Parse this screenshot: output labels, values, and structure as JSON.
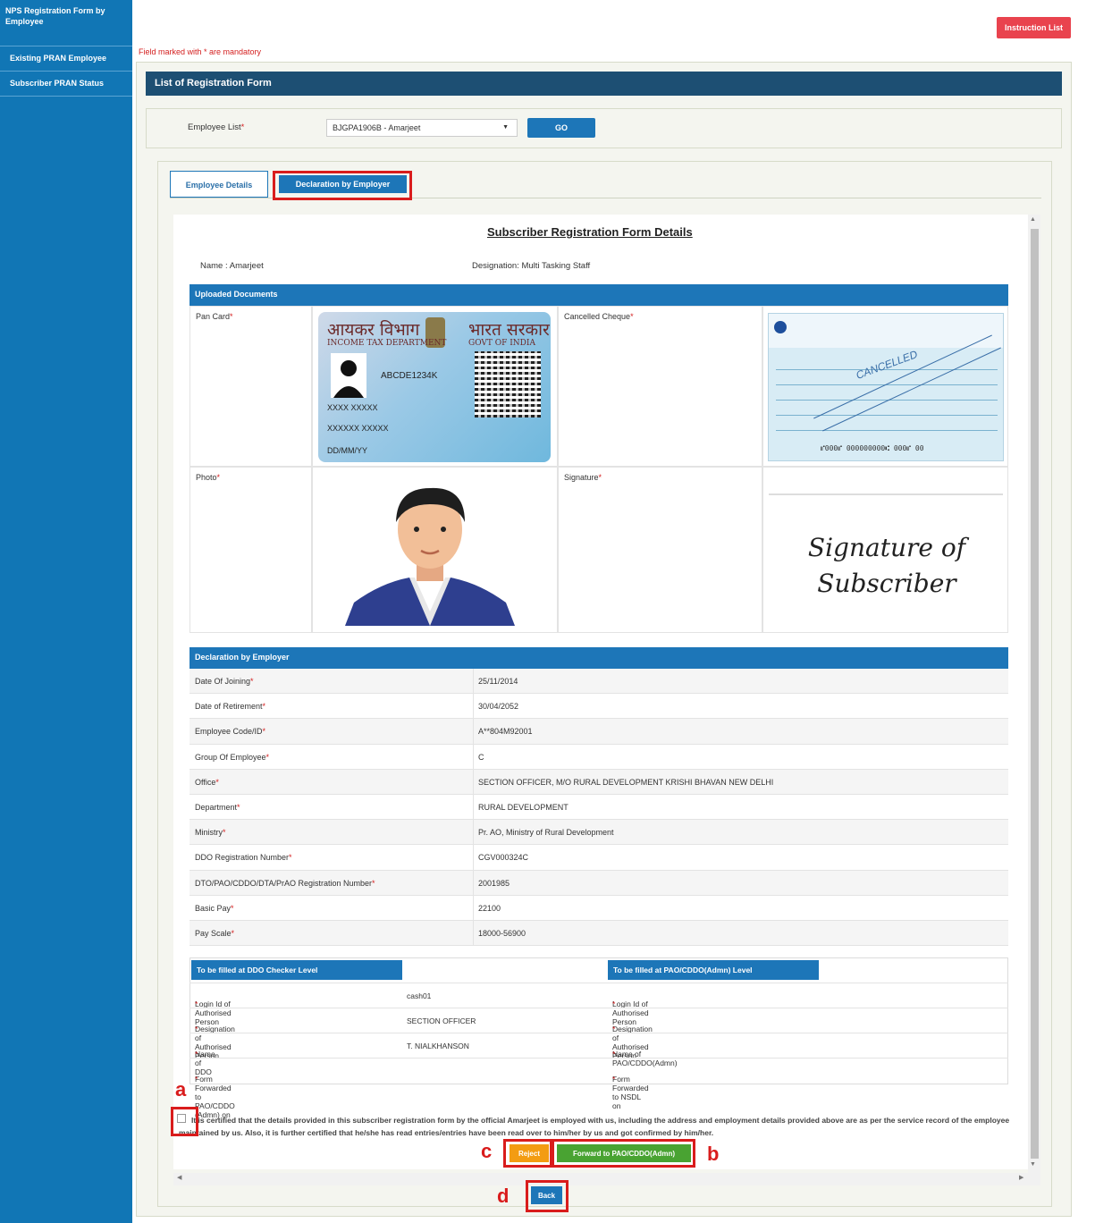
{
  "sidebar": {
    "items": [
      {
        "label": "NPS Registration Form by Employee"
      },
      {
        "label": "Existing PRAN Employee"
      },
      {
        "label": "Subscriber PRAN Status"
      }
    ]
  },
  "top": {
    "instruction_btn": "Instruction List",
    "mandatory_note": "Field marked with * are mandatory"
  },
  "panel_title": "List of Registration Form",
  "employee": {
    "label": "Employee List",
    "selected": "BJGPA1906B - Amarjeet",
    "go_label": "GO"
  },
  "tabs": [
    {
      "label": "Employee Details"
    },
    {
      "label": "Declaration by Employer"
    }
  ],
  "form": {
    "title": "Subscriber Registration Form Details",
    "name": "Name : Amarjeet",
    "designation": "Designation: Multi Tasking Staff",
    "uploaded_header": "Uploaded Documents",
    "docs": {
      "pan_label": "Pan Card",
      "cheque_label": "Cancelled Cheque",
      "photo_label": "Photo",
      "signature_label": "Signature",
      "signature_text": "Signature of Subscriber"
    },
    "pan_card": {
      "hindi_left": "आयकर विभाग",
      "hindi_right": "भारत सरकार",
      "eng_left": "INCOME TAX DEPARTMENT",
      "eng_right": "GOVT OF INDIA",
      "pan": "ABCDE1234K",
      "name_line": "XXXX XXXXX",
      "father_line": "XXXXXX XXXXX",
      "dob": "DD/MM/YY"
    },
    "cheque": {
      "stamp": "CANCELLED",
      "micr": "⑈000⑈ 000000000⑆ 000⑈ 00"
    },
    "declaration_header": "Declaration by Employer",
    "declaration_rows": [
      {
        "k": "Date Of Joining",
        "v": "25/11/2014"
      },
      {
        "k": "Date of Retirement",
        "v": "30/04/2052"
      },
      {
        "k": "Employee Code/ID",
        "v": "A**804M92001"
      },
      {
        "k": "Group Of Employee",
        "v": "C"
      },
      {
        "k": "Office",
        "v": "SECTION OFFICER, M/O RURAL DEVELOPMENT KRISHI BHAVAN NEW DELHI"
      },
      {
        "k": "Department",
        "v": "RURAL DEVELOPMENT"
      },
      {
        "k": "Ministry",
        "v": "Pr. AO, Ministry of Rural Development"
      },
      {
        "k": "DDO Registration Number",
        "v": "CGV000324C"
      },
      {
        "k": "DTO/PAO/CDDO/DTA/PrAO Registration Number",
        "v": "2001985"
      },
      {
        "k": "Basic Pay",
        "v": "22100"
      },
      {
        "k": "Pay Scale",
        "v": "18000-56900"
      }
    ],
    "checker": {
      "ddo_header": "To be filled at DDO Checker Level",
      "pao_header": "To be filled at PAO/CDDO(Admn) Level",
      "rows": [
        {
          "k1": "Login Id of Authorised Person",
          "v1": "cash01",
          "k2": "Login Id of Authorised Person",
          "v2": ""
        },
        {
          "k1": "Designation of Authorised Person",
          "v1": "SECTION OFFICER",
          "k2": "Designation of Authorised Person",
          "v2": ""
        },
        {
          "k1": "Name of DDO",
          "v1": "T. NIALKHANSON",
          "k2": "Name of PAO/CDDO(Admn)",
          "v2": ""
        },
        {
          "k1": "Form Forwarded to PAO/CDDO (Admn) on",
          "v1": "",
          "k2": "Form Forwarded to NSDL on",
          "v2": ""
        }
      ]
    },
    "declaration_text": "It is certified that the details provided in this subscriber registration form by the official Amarjeet is employed with us, including the address and employment details provided above are as per the service record of the employee maintained by us. Also, it is further certified that he/she has read entries/entries have been read over to him/her by us and got confirmed by him/her.",
    "reject_label": "Reject",
    "forward_label": "Forward to PAO/CDDO(Admn)",
    "back_label": "Back"
  },
  "annotations": {
    "a": "a",
    "b": "b",
    "c": "c",
    "d": "d"
  },
  "colors": {
    "sidebar": "#1176b5",
    "header": "#1d4f73",
    "section": "#1d76b8",
    "highlight": "#d91c1c",
    "reject": "#f39c12",
    "forward": "#49a332"
  }
}
